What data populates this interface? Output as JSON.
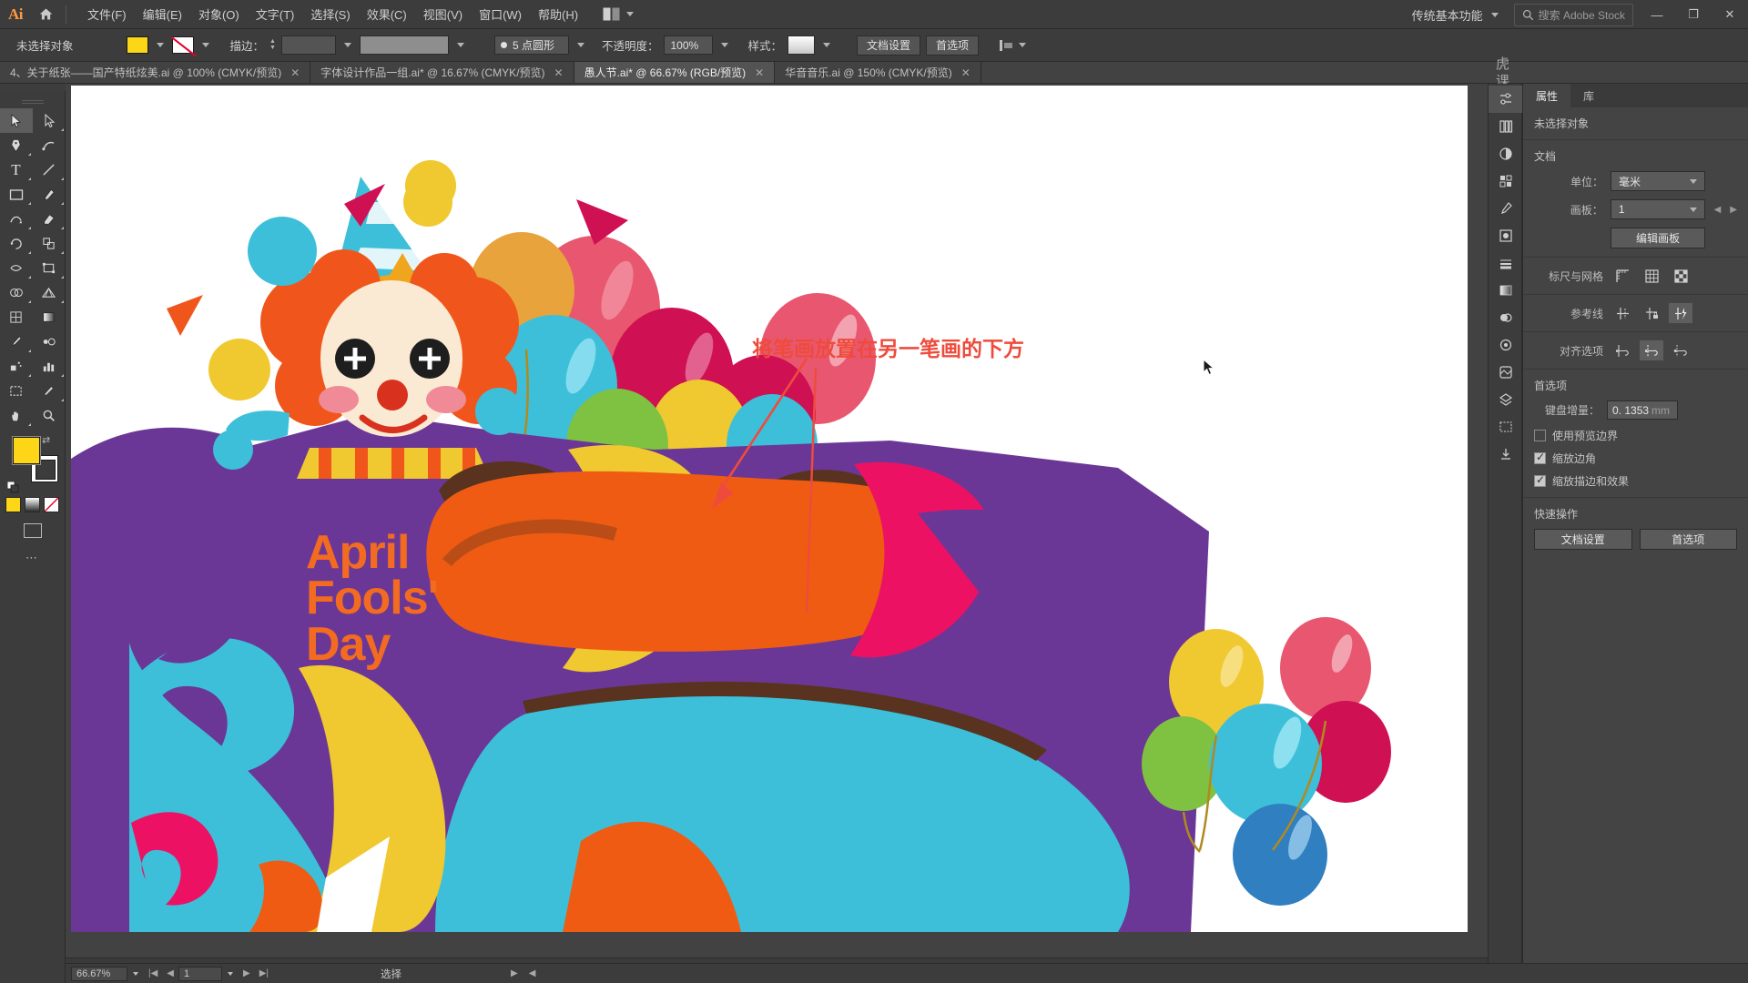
{
  "app": {
    "name": "Ai",
    "workspace": "传统基本功能",
    "search_placeholder": "搜索 Adobe Stock"
  },
  "menubar": {
    "items": [
      "文件(F)",
      "编辑(E)",
      "对象(O)",
      "文字(T)",
      "选择(S)",
      "效果(C)",
      "视图(V)",
      "窗口(W)",
      "帮助(H)"
    ]
  },
  "window_controls": {
    "minimize": "—",
    "maximize": "❐",
    "close": "✕"
  },
  "controlbar": {
    "selection_status": "未选择对象",
    "fill_color": "#fcd617",
    "stroke_color": "none",
    "stroke_label": "描边：",
    "stroke_weight": "",
    "stroke_profile": "5 点圆形",
    "opacity_label": "不透明度：",
    "opacity_value": "100%",
    "style_label": "样式：",
    "doc_setup_button": "文档设置",
    "preferences_button": "首选项"
  },
  "tabs": [
    {
      "label": "4、关于纸张——国产特纸炫美.ai @ 100% (CMYK/预览)",
      "active": false,
      "close": "✕"
    },
    {
      "label": "字体设计作品一组.ai* @ 16.67% (CMYK/预览)",
      "active": false,
      "close": "✕"
    },
    {
      "label": "愚人节.ai* @ 66.67% (RGB/预览)",
      "active": true,
      "close": "✕"
    },
    {
      "label": "华音音乐.ai @ 150% (CMYK/预览)",
      "active": false,
      "close": "✕"
    }
  ],
  "toolbar": {
    "tools": [
      "selection-tool",
      "direct-selection-tool",
      "pen-tool",
      "curvature-tool",
      "type-tool",
      "line-segment-tool",
      "rectangle-tool",
      "paintbrush-tool",
      "shaper-tool",
      "eraser-tool",
      "rotate-tool",
      "scale-tool",
      "width-tool",
      "free-transform-tool",
      "shape-builder-tool",
      "perspective-grid-tool",
      "mesh-tool",
      "gradient-tool",
      "eyedropper-tool",
      "blend-tool",
      "symbol-sprayer-tool",
      "column-graph-tool",
      "artboard-tool",
      "slice-tool",
      "hand-tool",
      "zoom-tool"
    ],
    "fill_color": "#fcd617",
    "stroke_color": "#ffffff",
    "more_tools": "⋯"
  },
  "canvas": {
    "annotation": "将笔画放置在另一笔画的下方",
    "artwork_title_lines": [
      "April",
      "Fools'",
      "Day"
    ],
    "annotation_color": "#ef4b3c"
  },
  "watermark": {
    "text": "虎课网"
  },
  "properties": {
    "tabs": [
      {
        "label": "属性",
        "active": true
      },
      {
        "label": "库",
        "active": false
      }
    ],
    "no_selection": "未选择对象",
    "document": {
      "title": "文档",
      "unit_label": "单位：",
      "unit_value": "毫米",
      "artboard_label": "画板：",
      "artboard_value": "1",
      "edit_artboard_button": "编辑画板"
    },
    "rulers_grids": {
      "title": "标尺与网格",
      "icons": [
        "rulers-icon",
        "grid-icon",
        "transparency-grid-icon"
      ]
    },
    "guides": {
      "title": "参考线",
      "icons": [
        "show-guides-icon",
        "lock-guides-icon",
        "smart-guides-icon"
      ]
    },
    "align_options": {
      "title": "对齐选项",
      "icons": [
        "align-pixel-grid-icon",
        "align-grid-icon",
        "align-point-icon"
      ]
    },
    "preferences": {
      "title": "首选项",
      "keyboard_increment_label": "键盘增量：",
      "keyboard_increment_value": "0. 1353",
      "keyboard_increment_unit": "mm",
      "checkboxes": [
        {
          "label": "使用预览边界",
          "checked": false
        },
        {
          "label": "缩放边角",
          "checked": true
        },
        {
          "label": "缩放描边和效果",
          "checked": true
        }
      ]
    },
    "quick_actions": {
      "title": "快速操作",
      "buttons": [
        "文档设置",
        "首选项"
      ]
    }
  },
  "dock_icons": [
    "properties-icon",
    "libraries-icon",
    "color-icon",
    "swatches-icon",
    "brushes-icon",
    "symbols-icon",
    "stroke-icon",
    "gradient-icon",
    "transparency-icon",
    "appearance-icon",
    "graphic-styles-icon",
    "layers-icon",
    "artboards-icon",
    "asset-export-icon"
  ],
  "statusbar": {
    "zoom_level": "66.67%",
    "page_number": "1",
    "current_tool": "选择"
  }
}
